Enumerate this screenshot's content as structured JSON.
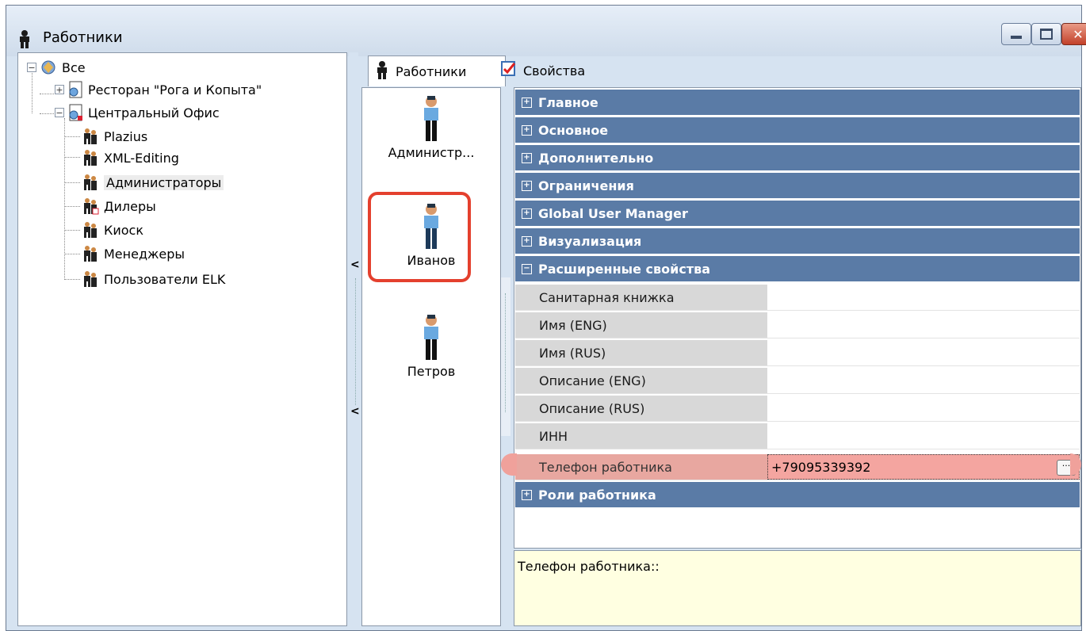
{
  "window": {
    "title": "Работники",
    "icon": "employee-icon",
    "controls": [
      "minimize",
      "maximize",
      "close"
    ]
  },
  "tree": {
    "root": "Все",
    "nodes": [
      {
        "label": "Ресторан \"Рога и Копыта\"",
        "icon": "org-icon",
        "expander": "+"
      },
      {
        "label": "Центральный Офис",
        "icon": "org-icon",
        "expander": "−"
      }
    ],
    "groups": [
      "Plazius",
      "XML-Editing",
      "Администраторы",
      "Дилеры",
      "Киоск",
      "Менеджеры",
      "Пользователи ELK"
    ],
    "selected": "Администраторы"
  },
  "tabs": [
    {
      "label": "Работники",
      "icon": "employee-icon",
      "active": true
    },
    {
      "label": "Свойства",
      "icon": "properties-icon",
      "active": false
    }
  ],
  "employees": [
    {
      "label": "Администр..."
    },
    {
      "label": "Иванов"
    },
    {
      "label": "Петров"
    }
  ],
  "selected_employee": "Иванов",
  "categories_top": [
    "Главное",
    "Основное",
    "Дополнительно",
    "Ограничения",
    "Global User Manager",
    "Визуализация"
  ],
  "expanded_category": "Расширенные свойства",
  "properties": [
    {
      "name": "Санитарная книжка",
      "value": ""
    },
    {
      "name": "Имя (ENG)",
      "value": ""
    },
    {
      "name": "Имя (RUS)",
      "value": ""
    },
    {
      "name": "Описание (ENG)",
      "value": ""
    },
    {
      "name": "Описание (RUS)",
      "value": ""
    },
    {
      "name": "ИНН",
      "value": ""
    },
    {
      "name": "Телефон работника",
      "value": "+79095339392"
    }
  ],
  "category_bottom": "Роли работника",
  "description": "Телефон работника::",
  "colors": {
    "category_bg": "#5a7ba6",
    "highlight": "#f4a5a0",
    "selection_border": "#e4402e",
    "description_bg": "#ffffe1"
  }
}
